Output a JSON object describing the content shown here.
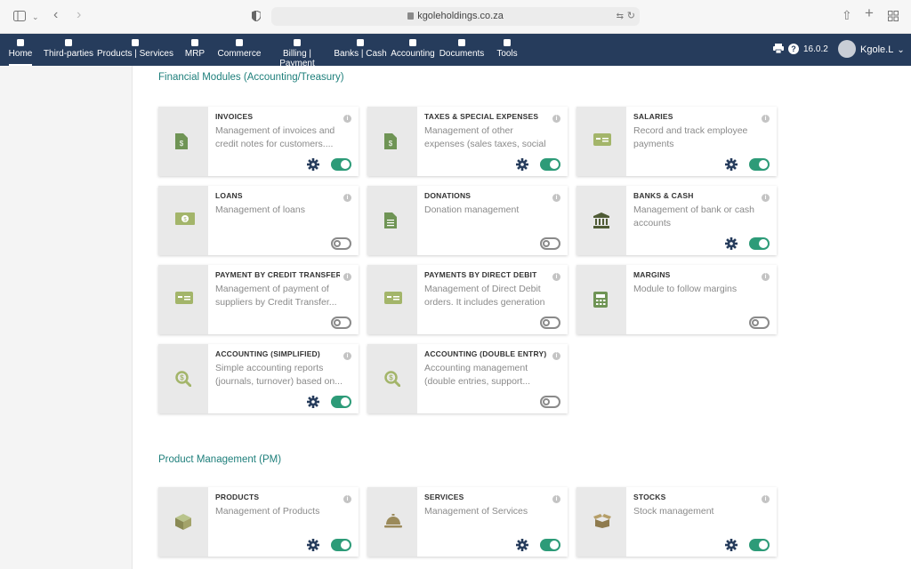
{
  "browser": {
    "url": "kgoleholdings.co.za"
  },
  "nav": {
    "items": [
      {
        "label": "Home"
      },
      {
        "label": "Third-parties"
      },
      {
        "label": "Products | Services"
      },
      {
        "label": "MRP"
      },
      {
        "label": "Commerce"
      },
      {
        "label": "Billing | Payment"
      },
      {
        "label": "Banks | Cash"
      },
      {
        "label": "Accounting"
      },
      {
        "label": "Documents"
      },
      {
        "label": "Tools"
      }
    ],
    "version": "16.0.2",
    "user": "Kgole.L"
  },
  "sections": [
    {
      "title": "Financial Modules (Accounting/Treasury)",
      "cards": [
        {
          "title": "INVOICES",
          "desc": "Management of invoices and credit notes for customers....",
          "icon": "invoice-icon",
          "gear": true,
          "enabled": true
        },
        {
          "title": "TAXES & SPECIAL EXPENSES",
          "desc": "Management of other expenses (sales taxes, social or fiscal...",
          "icon": "invoice-icon",
          "gear": true,
          "enabled": true
        },
        {
          "title": "SALARIES",
          "desc": "Record and track employee payments",
          "icon": "payment-card-icon",
          "gear": true,
          "enabled": true
        },
        {
          "title": "LOANS",
          "desc": "Management of loans",
          "icon": "money-icon",
          "gear": false,
          "enabled": false
        },
        {
          "title": "DONATIONS",
          "desc": "Donation management",
          "icon": "document-icon",
          "gear": false,
          "enabled": false
        },
        {
          "title": "BANKS & CASH",
          "desc": "Management of bank or cash accounts",
          "icon": "bank-icon",
          "gear": true,
          "enabled": true
        },
        {
          "title": "PAYMENT BY CREDIT TRANSFER",
          "desc": "Management of payment of suppliers by Credit Transfer...",
          "icon": "payment-card-icon",
          "gear": false,
          "enabled": false
        },
        {
          "title": "PAYMENTS BY DIRECT DEBIT",
          "desc": "Management of Direct Debit orders. It includes generation ...",
          "icon": "payment-card-icon",
          "gear": false,
          "enabled": false
        },
        {
          "title": "MARGINS",
          "desc": "Module to follow margins",
          "icon": "calculator-icon",
          "gear": false,
          "enabled": false
        },
        {
          "title": "ACCOUNTING (SIMPLIFIED)",
          "desc": "Simple accounting reports (journals, turnover) based on...",
          "icon": "search-dollar-icon",
          "gear": true,
          "enabled": true
        },
        {
          "title": "ACCOUNTING (DOUBLE ENTRY)",
          "desc": "Accounting management (double entries, support...",
          "icon": "search-dollar-icon",
          "gear": false,
          "enabled": false
        }
      ]
    },
    {
      "title": "Product Management (PM)",
      "cards": [
        {
          "title": "PRODUCTS",
          "desc": "Management of Products",
          "icon": "cube-icon",
          "gear": true,
          "enabled": true
        },
        {
          "title": "SERVICES",
          "desc": "Management of Services",
          "icon": "service-bell-icon",
          "gear": true,
          "enabled": true
        },
        {
          "title": "STOCKS",
          "desc": "Stock management",
          "icon": "box-open-icon",
          "gear": true,
          "enabled": true
        }
      ]
    }
  ],
  "colors": {
    "navbar": "#263c5c",
    "accent": "#1e7f7b",
    "toggle_on": "#2d9b78",
    "icon": "#a3b56a",
    "gear": "#263c5c"
  }
}
